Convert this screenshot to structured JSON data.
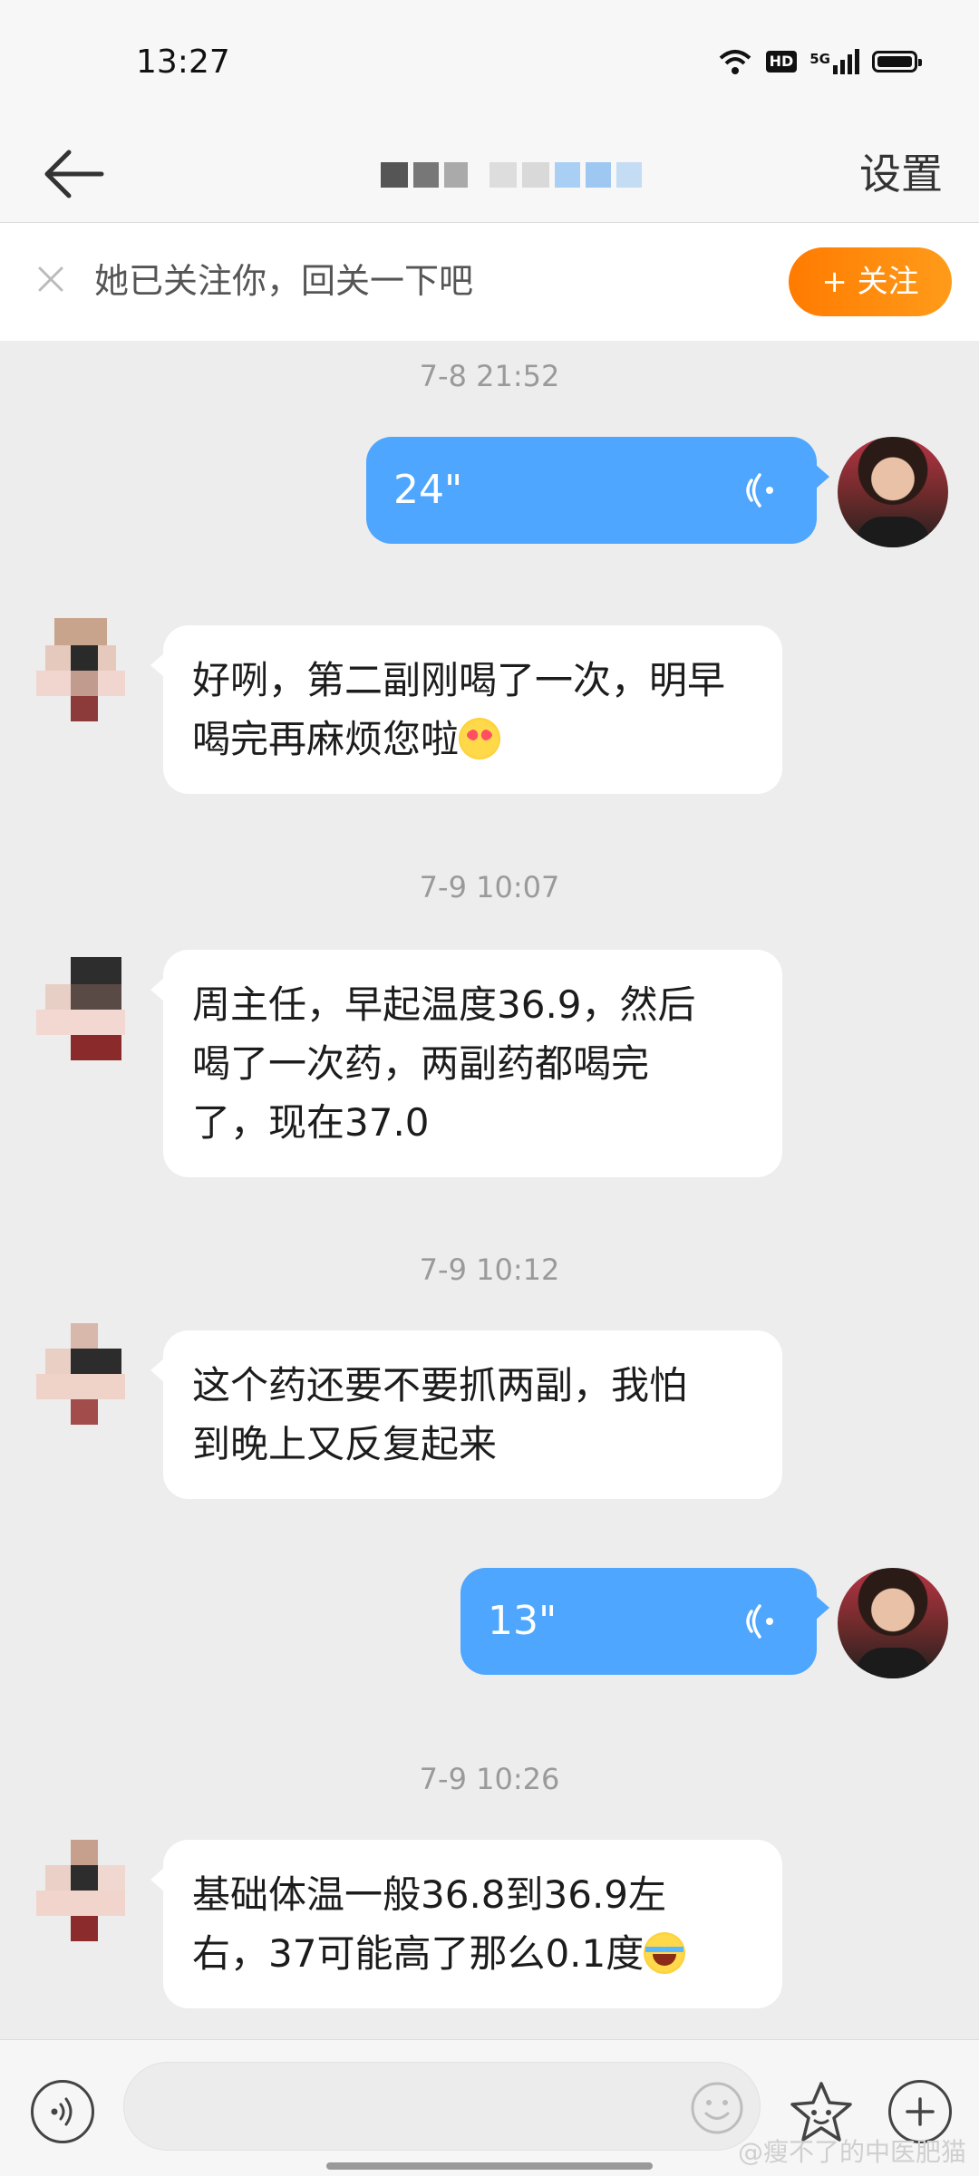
{
  "status_bar": {
    "time": "13:27",
    "hd_label": "HD",
    "network_label": "5G",
    "icons": [
      "wifi-icon",
      "hd-icon",
      "5g-signal-icon",
      "battery-icon"
    ]
  },
  "nav": {
    "back_icon": "arrow-left-icon",
    "settings_label": "设置"
  },
  "follow_bar": {
    "text": "她已关注你，回关一下吧",
    "button_label": "+ 关注",
    "close_icon": "close-icon"
  },
  "messages": [
    {
      "type": "timestamp",
      "text": "7-8 21:52"
    },
    {
      "type": "voice",
      "sender": "me",
      "duration": "24\""
    },
    {
      "type": "text",
      "sender": "other",
      "text": "好咧，第二副刚喝了一次，明早喝完再麻烦您啦",
      "emoji": "kiss-emoji"
    },
    {
      "type": "timestamp",
      "text": "7-9 10:07"
    },
    {
      "type": "text",
      "sender": "other",
      "lines": [
        "周主任，早起温度36.9，然后",
        "喝了一次药，两副药都喝完",
        "了，现在37.0"
      ]
    },
    {
      "type": "timestamp",
      "text": "7-9 10:12"
    },
    {
      "type": "text",
      "sender": "other",
      "lines": [
        "这个药还要不要抓两副，我怕",
        "到晚上又反复起来"
      ]
    },
    {
      "type": "voice",
      "sender": "me",
      "duration": "13\""
    },
    {
      "type": "timestamp",
      "text": "7-9 10:26"
    },
    {
      "type": "text",
      "sender": "other",
      "lines": [
        "基础体温一般36.8到36.9左",
        "右，37可能高了那么0.1度"
      ],
      "emoji": "laugh-emoji"
    }
  ],
  "input_bar": {
    "placeholder": "",
    "icons": [
      "voice-mode-icon",
      "smile-icon",
      "sticker-icon",
      "plus-icon"
    ]
  },
  "watermark": "@瘦不了的中医肥猫",
  "colors": {
    "background": "#ededed",
    "bubble_me": "#4ea6ff",
    "bubble_other": "#ffffff",
    "follow_button": "#ff8c00"
  }
}
